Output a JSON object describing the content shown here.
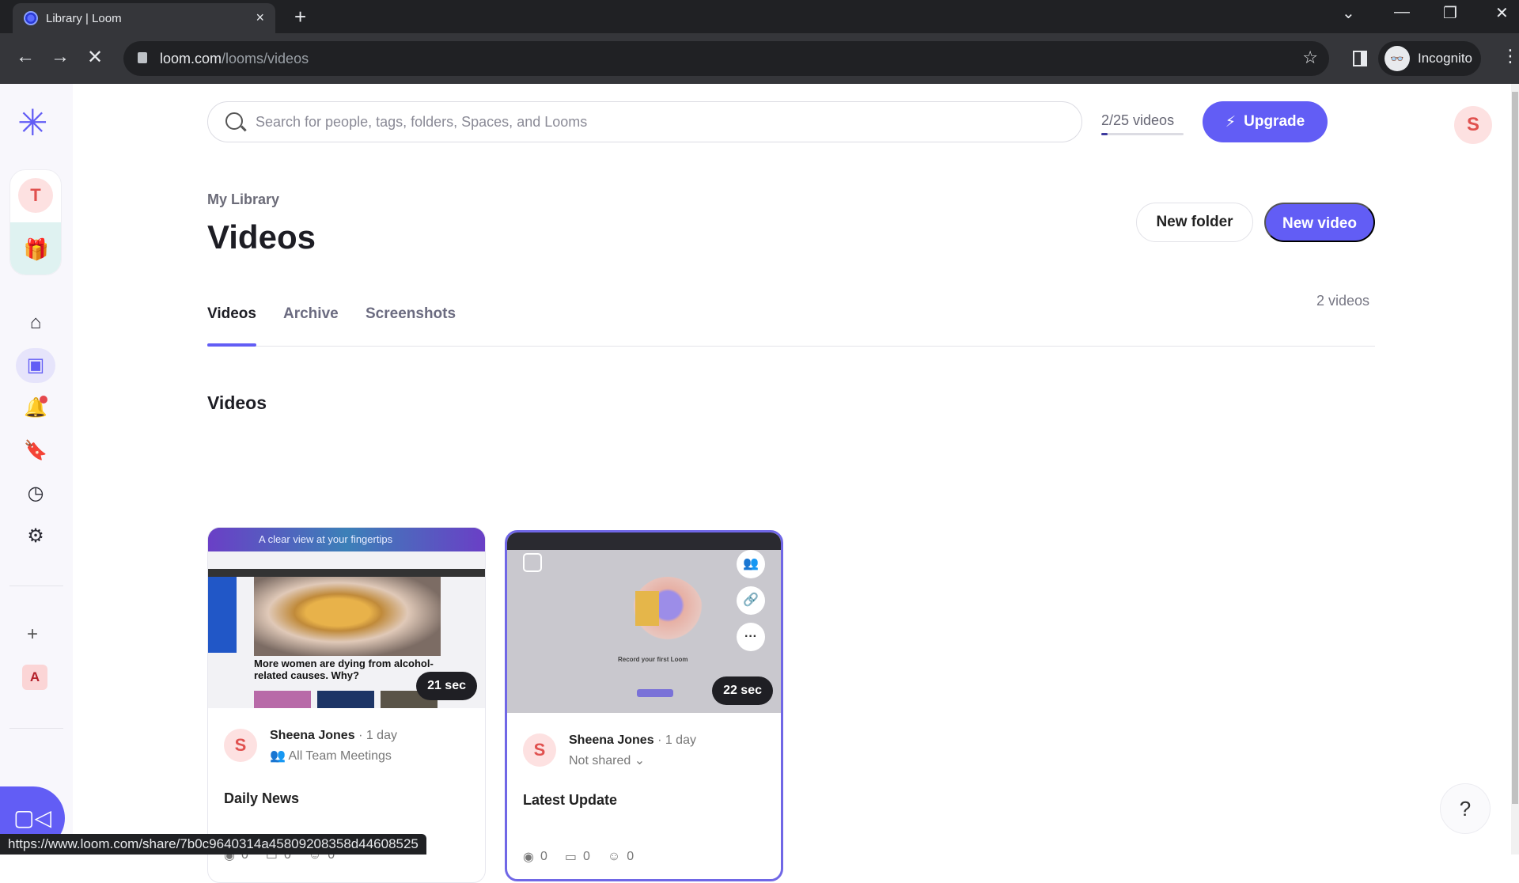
{
  "browser": {
    "tab_title": "Library | Loom",
    "tab_close": "×",
    "new_tab": "+",
    "url_host": "loom.com",
    "url_path": "/looms/videos",
    "profile_label": "Incognito",
    "status_url": "https://www.loom.com/share/7b0c9640314a45809208358d44608525",
    "icons": {
      "back": "←",
      "forward": "→",
      "stop": "✕",
      "star": "☆",
      "menu": "⋮",
      "tab_search": "⌄",
      "minimize": "—",
      "restore": "❐",
      "close": "✕"
    }
  },
  "rail": {
    "logo": "✳",
    "workspace_initial": "T",
    "gift_icon": "🎁",
    "items": [
      {
        "name": "home",
        "glyph": "⌂"
      },
      {
        "name": "library",
        "glyph": "▣"
      },
      {
        "name": "notifications",
        "glyph": "🔔"
      },
      {
        "name": "bookmarks",
        "glyph": "🔖"
      },
      {
        "name": "history",
        "glyph": "◷"
      },
      {
        "name": "settings",
        "glyph": "⚙"
      }
    ],
    "add_label": "+",
    "space_initial": "A",
    "record_icon": "▭◁"
  },
  "topbar": {
    "search_placeholder": "Search for people, tags, folders, Spaces, and Looms",
    "quota_label": "2/25 videos",
    "quota_fraction": 0.08,
    "upgrade_label": "Upgrade",
    "upgrade_icon": "⚡",
    "user_initial": "S"
  },
  "header": {
    "breadcrumb": "My Library",
    "title": "Videos",
    "new_folder_label": "New folder",
    "new_video_label": "New video"
  },
  "tabs": [
    {
      "label": "Videos",
      "active": true
    },
    {
      "label": "Archive",
      "active": false
    },
    {
      "label": "Screenshots",
      "active": false
    }
  ],
  "video_count": "2 videos",
  "section_title": "Videos",
  "videos": [
    {
      "thumb_banner": "A clear view at your fingertips",
      "thumb_headline": "More women are dying from alcohol-related causes. Why?",
      "duration": "21 sec",
      "author_initial": "S",
      "author": "Sheena Jones",
      "time": "· 1 day",
      "sharing": "All Team Meetings",
      "title": "Daily News",
      "views": "0",
      "comments": "0",
      "reactions": "0"
    },
    {
      "thumb_caption": "Record your first Loom",
      "duration": "22 sec",
      "author_initial": "S",
      "author": "Sheena Jones",
      "time": "· 1 day",
      "sharing": "Not shared",
      "title": "Latest Update",
      "views": "0",
      "comments": "0",
      "reactions": "0"
    }
  ],
  "help_label": "?",
  "colors": {
    "accent": "#625df5",
    "avatar_bg": "#fde1e1",
    "avatar_fg": "#e0514f",
    "notification_dot": "#e5484d"
  }
}
